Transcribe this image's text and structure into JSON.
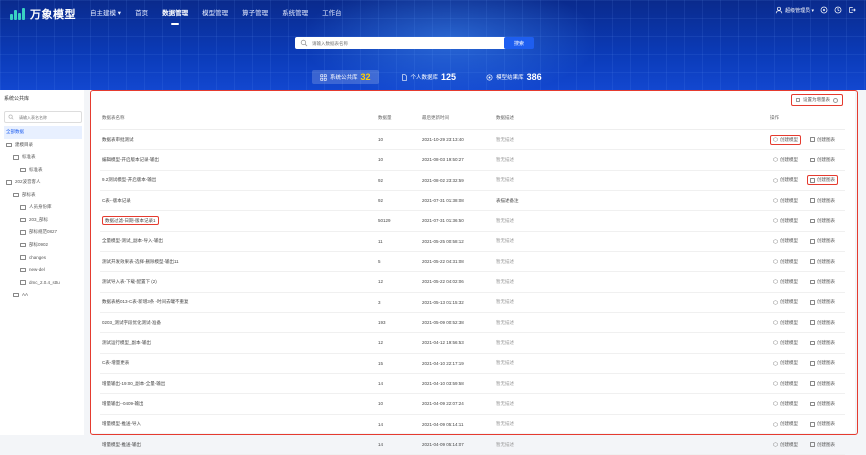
{
  "header": {
    "logo_text": "万象模型",
    "nav": [
      {
        "label": "自主建模 ▾",
        "active": false
      },
      {
        "label": "首页",
        "active": false
      },
      {
        "label": "数据管理",
        "active": true
      },
      {
        "label": "模型管理",
        "active": false
      },
      {
        "label": "算子管理",
        "active": false
      },
      {
        "label": "系统管理",
        "active": false
      },
      {
        "label": "工作台",
        "active": false
      }
    ],
    "user": {
      "name": "超级管理员 ▾"
    }
  },
  "search": {
    "placeholder": "请输入数据表名称",
    "button": "搜索"
  },
  "tabs": [
    {
      "label": "系统公共库",
      "count": "32",
      "active": true
    },
    {
      "label": "个人数据库",
      "count": "125",
      "active": false
    },
    {
      "label": "模型结果库",
      "count": "386",
      "active": false
    }
  ],
  "sidebar": {
    "title": "系统公共库",
    "search_placeholder": "请输入表名名称",
    "tree": [
      {
        "label": "全部数据",
        "level": 0,
        "selected": true,
        "folder": false
      },
      {
        "label": "建模目录",
        "level": 0,
        "folder": true
      },
      {
        "label": "标准表",
        "level": 1,
        "folder": true
      },
      {
        "label": "标准表",
        "level": 2,
        "folder": true
      },
      {
        "label": "202波音客人",
        "level": 0,
        "folder": true
      },
      {
        "label": "部标表",
        "level": 1,
        "folder": true
      },
      {
        "label": "人员身份库",
        "level": 2,
        "folder": true
      },
      {
        "label": "203_部标",
        "level": 2,
        "folder": true
      },
      {
        "label": "部标规范0827",
        "level": 2,
        "folder": true
      },
      {
        "label": "部标0902",
        "level": 2,
        "folder": true
      },
      {
        "label": "changes",
        "level": 2,
        "folder": true
      },
      {
        "label": "new-del",
        "level": 2,
        "folder": true
      },
      {
        "label": "dmc_2.0.4_sttu",
        "level": 2,
        "folder": true
      },
      {
        "label": "AA",
        "level": 1,
        "folder": true
      }
    ]
  },
  "table": {
    "header_button": "设置为增量表",
    "columns": [
      "数据表名称",
      "数据量",
      "最后更新时间",
      "数据描述",
      "操作"
    ],
    "op_labels": {
      "model": "创建模型",
      "chart": "创建图表"
    },
    "rows": [
      {
        "name": "数据表审批测试",
        "count": "10",
        "time": "2021-10-29 23:13:40",
        "desc": "暂无描述",
        "has_desc": false,
        "hl_name": false,
        "hl_model": true,
        "hl_chart": false
      },
      {
        "name": "编辑模型-开启版本记录-输出",
        "count": "10",
        "time": "2021-08-03 19:50:27",
        "desc": "暂无描述",
        "has_desc": false,
        "hl_name": false,
        "hl_model": false,
        "hl_chart": false
      },
      {
        "name": "9.2测试模型-开启版本-输出",
        "count": "92",
        "time": "2021-08-02 23:32:59",
        "desc": "暂无描述",
        "has_desc": false,
        "hl_name": false,
        "hl_model": false,
        "hl_chart": true
      },
      {
        "name": "C表--版本记录",
        "count": "92",
        "time": "2021-07-31 01:38:08",
        "desc": "表描述备注",
        "has_desc": true,
        "hl_name": false,
        "hl_model": false,
        "hl_chart": false
      },
      {
        "name": "数据过滤-日期-版本记录1",
        "count": "50129",
        "time": "2021-07-31 01:36:50",
        "desc": "暂无描述",
        "has_desc": false,
        "hl_name": true,
        "hl_model": false,
        "hl_chart": false
      },
      {
        "name": "全量模型-测试_副本-导入-输出",
        "count": "11",
        "time": "2021-05-25 00:58:12",
        "desc": "暂无描述",
        "has_desc": false,
        "hl_name": false,
        "hl_model": false,
        "hl_chart": false
      },
      {
        "name": "测试开发效果表-选择-删除模型-输出11",
        "count": "5",
        "time": "2021-05-22 04:31:08",
        "desc": "暂无描述",
        "has_desc": false,
        "hl_name": false,
        "hl_model": false,
        "hl_chart": false
      },
      {
        "name": "测试导入表-下载-配置下 (2)",
        "count": "12",
        "time": "2021-05-22 04:02:06",
        "desc": "暂无描述",
        "has_desc": false,
        "hl_name": false,
        "hl_model": false,
        "hl_chart": false
      },
      {
        "name": "数据表格013-C表-新增3条 -时间去罐不重复",
        "count": "3",
        "time": "2021-05-13 01:15:32",
        "desc": "暂无描述",
        "has_desc": false,
        "hl_name": false,
        "hl_model": false,
        "hl_chart": false
      },
      {
        "name": "0203_测试字段优化测试-准备",
        "count": "193",
        "time": "2021-05-09 00:52:38",
        "desc": "暂无描述",
        "has_desc": false,
        "hl_name": false,
        "hl_model": false,
        "hl_chart": false
      },
      {
        "name": "测试运行模型_副本-输出",
        "count": "12",
        "time": "2021-04-12 19:56:53",
        "desc": "暂无描述",
        "has_desc": false,
        "hl_name": false,
        "hl_model": false,
        "hl_chart": false
      },
      {
        "name": "C表-增量更表",
        "count": "15",
        "time": "2021-04-10 22:17:19",
        "desc": "暂无描述",
        "has_desc": false,
        "hl_name": false,
        "hl_model": false,
        "hl_chart": false
      },
      {
        "name": "增量输出-19:00_副本-全量-输出",
        "count": "14",
        "time": "2021-04-10 03:59:58",
        "desc": "暂无描述",
        "has_desc": false,
        "hl_name": false,
        "hl_model": false,
        "hl_chart": false
      },
      {
        "name": "增量输出--0409-输出",
        "count": "10",
        "time": "2021-04-09 22:07:24",
        "desc": "暂无描述",
        "has_desc": false,
        "hl_name": false,
        "hl_model": false,
        "hl_chart": false
      },
      {
        "name": "增量模型-推送-导入",
        "count": "14",
        "time": "2021-04-09 05:14:11",
        "desc": "暂无描述",
        "has_desc": false,
        "hl_name": false,
        "hl_model": false,
        "hl_chart": false
      },
      {
        "name": "增量模型-推送-输出",
        "count": "14",
        "time": "2021-04-09 05:14:07",
        "desc": "暂无描述",
        "has_desc": false,
        "hl_name": false,
        "hl_model": false,
        "hl_chart": false
      }
    ]
  }
}
